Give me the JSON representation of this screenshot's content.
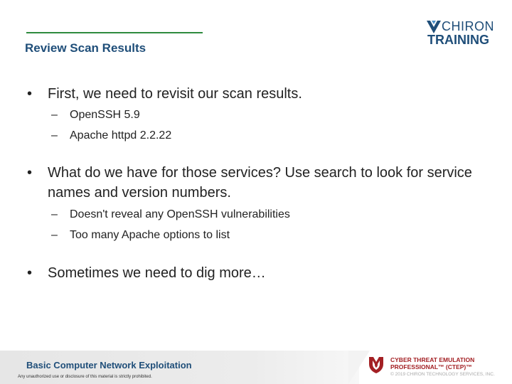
{
  "slide": {
    "title": "Review Scan Results"
  },
  "logo": {
    "line1": "CHIRON",
    "line2": "TRAINING",
    "mark_icon": "chiron-chevron-icon"
  },
  "bullets": [
    {
      "text": "First, we need to revisit our scan results.",
      "subs": [
        "OpenSSH 5.9",
        "Apache httpd 2.2.22"
      ]
    },
    {
      "text": "What do we have for those services? Use search to look for service names and version numbers.",
      "subs": [
        "Doesn't reveal any OpenSSH vulnerabilities",
        "Too many Apache options to list"
      ]
    },
    {
      "text": "Sometimes we need to dig more…",
      "subs": []
    }
  ],
  "glyphs": {
    "bullet": "•",
    "dash": "–"
  },
  "footer": {
    "course": "Basic Computer Network Exploitation",
    "disclaimer": "Any unauthorized use or disclosure of this material is strictly prohibited.",
    "ctep_line1": "CYBER THREAT EMULATION",
    "ctep_line2": "PROFESSIONAL™ (CTEP)™",
    "copyright": "© 2019 CHIRON TECHNOLOGY SERVICES, INC."
  },
  "colors": {
    "title": "#1f4e79",
    "rule": "#2e8b3e",
    "ctep": "#a32024"
  }
}
